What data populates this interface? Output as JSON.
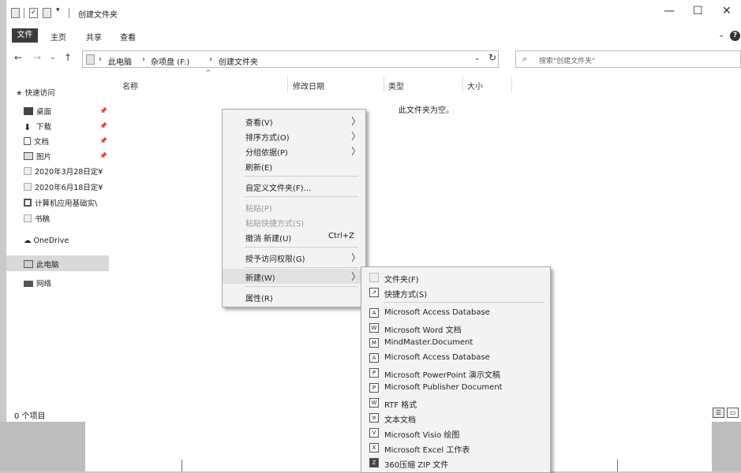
{
  "window": {
    "title": "创建文件夹",
    "controls": {
      "minimize": "—",
      "maximize": "☐",
      "close": "✕"
    }
  },
  "ribbon": {
    "tabs": [
      "文件",
      "主页",
      "共享",
      "查看"
    ],
    "expand_glyph": "⌄",
    "help_glyph": "?"
  },
  "address": {
    "crumbs": [
      "此电脑",
      "杂项盘 (F:)",
      "创建文件夹"
    ],
    "separator": "›",
    "search_placeholder": "搜索\"创建文件夹\""
  },
  "nav_glyphs": {
    "back": "←",
    "forward": "→",
    "recent": "⌄",
    "up": "↑",
    "refresh": "↻",
    "dropdown": "⌄"
  },
  "sidebar": {
    "quick_access": "快速访问",
    "items": [
      {
        "label": "桌面",
        "icon": "desktop-icon",
        "pinned": true
      },
      {
        "label": "下载",
        "icon": "download-icon",
        "pinned": true
      },
      {
        "label": "文档",
        "icon": "document-icon",
        "pinned": true
      },
      {
        "label": "图片",
        "icon": "picture-icon",
        "pinned": true
      },
      {
        "label": "2020年3月28日定¥",
        "icon": "folder-icon",
        "pinned": false
      },
      {
        "label": "2020年6月18日定¥",
        "icon": "folder-icon",
        "pinned": false
      },
      {
        "label": "计算机应用基础实\\",
        "icon": "folder-icon",
        "pinned": false
      },
      {
        "label": "书稿",
        "icon": "folder-icon",
        "pinned": false
      }
    ],
    "onedrive": "OneDrive",
    "this_pc": "此电脑",
    "network": "网络",
    "pin_glyph": "📌"
  },
  "columns": [
    "名称",
    "修改日期",
    "类型",
    "大小"
  ],
  "empty_message": "此文件夹为空。",
  "status": "0 个项目",
  "context_menu": {
    "items": [
      {
        "label": "查看(V)",
        "submenu": true
      },
      {
        "label": "排序方式(O)",
        "submenu": true
      },
      {
        "label": "分组依据(P)",
        "submenu": true
      },
      {
        "label": "刷新(E)"
      },
      {
        "label": "自定义文件夹(F)..."
      },
      {
        "label": "粘贴(P)",
        "disabled": true
      },
      {
        "label": "粘贴快捷方式(S)",
        "disabled": true
      },
      {
        "label": "撤消 新建(U)",
        "accelerator": "Ctrl+Z"
      },
      {
        "label": "授予访问权限(G)",
        "submenu": true
      },
      {
        "label": "新建(W)",
        "submenu": true,
        "highlighted": true
      },
      {
        "label": "属性(R)"
      }
    ],
    "arrow_glyph": "〉"
  },
  "new_submenu": {
    "items": [
      {
        "label": "文件夹(F)",
        "icon": "folder-icon"
      },
      {
        "label": "快捷方式(S)",
        "icon": "shortcut-icon"
      },
      {
        "label": "Microsoft Access Database",
        "icon": "access-icon"
      },
      {
        "label": "Microsoft Word 文档",
        "icon": "word-icon"
      },
      {
        "label": "MindMaster.Document",
        "icon": "mindmaster-icon"
      },
      {
        "label": "Microsoft Access Database",
        "icon": "access-icon"
      },
      {
        "label": "Microsoft PowerPoint 演示文稿",
        "icon": "powerpoint-icon"
      },
      {
        "label": "Microsoft Publisher Document",
        "icon": "publisher-icon"
      },
      {
        "label": "RTF 格式",
        "icon": "rtf-icon"
      },
      {
        "label": "文本文档",
        "icon": "text-document-icon"
      },
      {
        "label": "Microsoft Visio 绘图",
        "icon": "visio-icon"
      },
      {
        "label": "Microsoft Excel 工作表",
        "icon": "excel-icon"
      },
      {
        "label": "360压缩 ZIP 文件",
        "icon": "zip-icon"
      }
    ]
  }
}
